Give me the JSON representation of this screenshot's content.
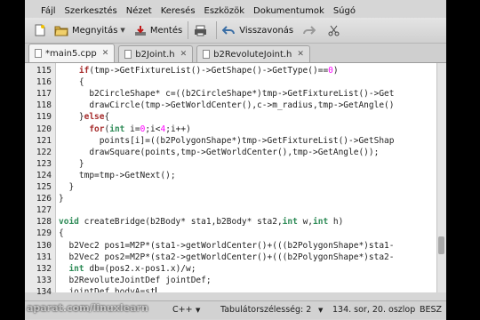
{
  "menubar": [
    "Fájl",
    "Szerkesztés",
    "Nézet",
    "Keresés",
    "Eszközök",
    "Dokumentumok",
    "Súgó"
  ],
  "toolbar": {
    "open_label": "Megnyitás",
    "save_label": "Mentés",
    "undo_label": "Visszavonás"
  },
  "tabs": [
    {
      "label": "*main5.cpp",
      "active": true
    },
    {
      "label": "b2Joint.h",
      "active": false
    },
    {
      "label": "b2RevoluteJoint.h",
      "active": false
    }
  ],
  "code_lines": [
    {
      "no": "115",
      "segs": [
        {
          "t": "    "
        },
        {
          "t": "if",
          "c": "kw"
        },
        {
          "t": "(tmp->GetFixtureList()->GetShape()->GetType()=="
        },
        {
          "t": "0",
          "c": "num"
        },
        {
          "t": ")"
        }
      ]
    },
    {
      "no": "116",
      "segs": [
        {
          "t": "    {"
        }
      ]
    },
    {
      "no": "117",
      "segs": [
        {
          "t": "      b2CircleShape* c=((b2CircleShape*)tmp->GetFixtureList()->Get"
        }
      ]
    },
    {
      "no": "118",
      "segs": [
        {
          "t": "      drawCircle(tmp->GetWorldCenter(),c->m_radius,tmp->GetAngle()"
        }
      ]
    },
    {
      "no": "119",
      "segs": [
        {
          "t": "    }"
        },
        {
          "t": "else",
          "c": "kw"
        },
        {
          "t": "{"
        }
      ]
    },
    {
      "no": "120",
      "segs": [
        {
          "t": "      "
        },
        {
          "t": "for",
          "c": "kw"
        },
        {
          "t": "("
        },
        {
          "t": "int",
          "c": "ty"
        },
        {
          "t": " i="
        },
        {
          "t": "0",
          "c": "num"
        },
        {
          "t": ";i<"
        },
        {
          "t": "4",
          "c": "num"
        },
        {
          "t": ";i++)"
        }
      ]
    },
    {
      "no": "121",
      "segs": [
        {
          "t": "        points[i]=((b2PolygonShape*)tmp->GetFixtureList()->GetShap"
        }
      ]
    },
    {
      "no": "122",
      "segs": [
        {
          "t": "      drawSquare(points,tmp->GetWorldCenter(),tmp->GetAngle());"
        }
      ]
    },
    {
      "no": "123",
      "segs": [
        {
          "t": "    }"
        }
      ]
    },
    {
      "no": "124",
      "segs": [
        {
          "t": "    tmp=tmp->GetNext();"
        }
      ]
    },
    {
      "no": "125",
      "segs": [
        {
          "t": "  }"
        }
      ]
    },
    {
      "no": "126",
      "segs": [
        {
          "t": "}"
        }
      ]
    },
    {
      "no": "127",
      "segs": [
        {
          "t": ""
        }
      ]
    },
    {
      "no": "128",
      "segs": [
        {
          "t": "void",
          "c": "ty"
        },
        {
          "t": " createBridge(b2Body* sta1,b2Body* sta2,"
        },
        {
          "t": "int",
          "c": "ty"
        },
        {
          "t": " w,"
        },
        {
          "t": "int",
          "c": "ty"
        },
        {
          "t": " h)"
        }
      ]
    },
    {
      "no": "129",
      "segs": [
        {
          "t": "{"
        }
      ]
    },
    {
      "no": "130",
      "segs": [
        {
          "t": "  b2Vec2 pos1=M2P*(sta1->getWorldCenter()+(((b2PolygonShape*)sta1-"
        }
      ]
    },
    {
      "no": "131",
      "segs": [
        {
          "t": "  b2Vec2 pos2=M2P*(sta2->getWorldCenter()+(((b2PolygonShape*)sta2-"
        }
      ]
    },
    {
      "no": "132",
      "segs": [
        {
          "t": "  "
        },
        {
          "t": "int",
          "c": "ty"
        },
        {
          "t": " db=(pos2.x-pos1.x)/w;"
        }
      ]
    },
    {
      "no": "133",
      "segs": [
        {
          "t": "  b2RevoluteJointDef jointDef;"
        }
      ]
    },
    {
      "no": "134",
      "segs": [
        {
          "t": "  jointDef.bodyA=st"
        }
      ],
      "cursor": true
    }
  ],
  "scrollbar": {
    "position": 0.82
  },
  "status": {
    "lang": "C++",
    "tabwidth": "Tabulátorszélesség:  2",
    "position": "134. sor, 20. oszlop",
    "mode": "BESZ"
  },
  "watermark": "aparat.com/linuxlearn",
  "colors": {
    "keyword": "#a52a2a",
    "type": "#2e8b57",
    "number": "#ff00ff"
  }
}
